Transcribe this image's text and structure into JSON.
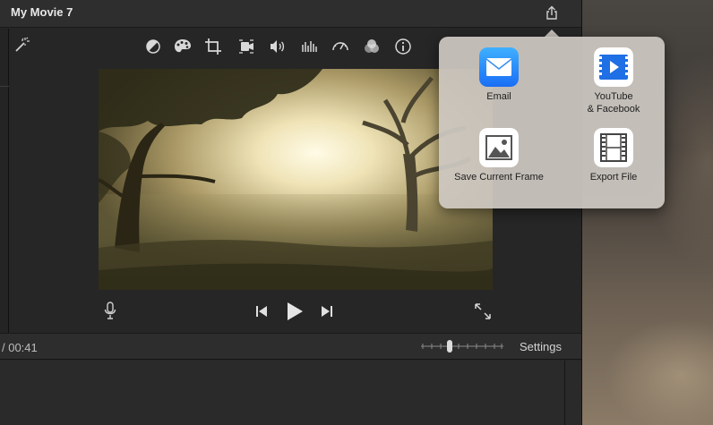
{
  "window": {
    "title": "My Movie 7"
  },
  "toolbar": {
    "icons": [
      "magic-wand-icon",
      "color-balance-icon",
      "color-correction-icon",
      "crop-icon",
      "stabilization-icon",
      "volume-icon",
      "equalizer-icon",
      "speed-icon",
      "clip-filter-icon",
      "info-icon"
    ]
  },
  "viewer": {
    "controls": [
      "microphone-icon",
      "skip-back-icon",
      "play-icon",
      "skip-forward-icon",
      "fullscreen-icon"
    ]
  },
  "timebar": {
    "timecode": "/  00:41",
    "settings_label": "Settings"
  },
  "share_menu": {
    "items": [
      {
        "label": "Email",
        "icon": "mail-icon"
      },
      {
        "label": "YouTube\n& Facebook",
        "icon": "youtube-facebook-icon"
      },
      {
        "label": "Save Current Frame",
        "icon": "image-frame-icon"
      },
      {
        "label": "Export File",
        "icon": "film-icon"
      }
    ]
  },
  "colors": {
    "accent_mail": "#1e7fff",
    "popover_bg": "#cdc8c2",
    "window_bg": "#262626"
  }
}
